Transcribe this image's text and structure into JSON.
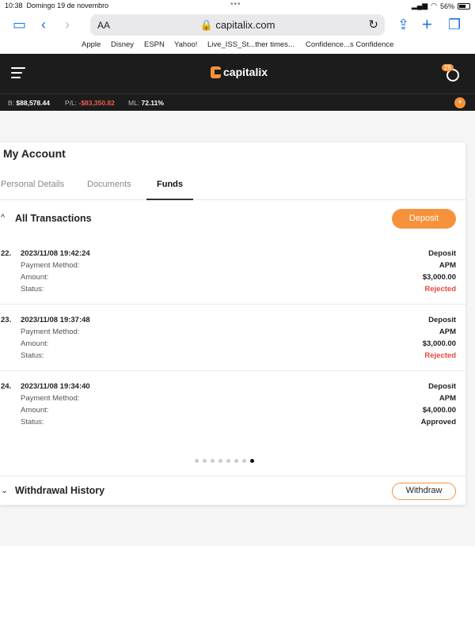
{
  "status_bar": {
    "time": "10:38",
    "date": "Domingo 19 de novembro",
    "battery": "56%"
  },
  "browser": {
    "aa_label": "AA",
    "url": "capitalix.com",
    "bookmarks": [
      "Apple",
      "Disney",
      "ESPN",
      "Yahoo!",
      "Live_ISS_St...ther times...",
      "Confidence...s Confidence"
    ]
  },
  "header": {
    "logo_text": "capitalix",
    "notification_count": "26"
  },
  "stats": {
    "balance_label": "B:",
    "balance_value": "$88,578.44",
    "pl_label": "P/L:",
    "pl_value": "-$83,350.82",
    "ml_label": "ML:",
    "ml_value": "72.11%"
  },
  "account": {
    "title": "My Account",
    "tabs": [
      "Personal Details",
      "Documents",
      "Funds"
    ],
    "active_tab": "Funds"
  },
  "transactions": {
    "title": "All Transactions",
    "deposit_label": "Deposit",
    "field_labels": {
      "method": "Payment Method:",
      "amount": "Amount:",
      "status": "Status:"
    },
    "items": [
      {
        "num": "22.",
        "date": "2023/11/08 19:42:24",
        "type": "Deposit",
        "method": "APM",
        "amount": "$3,000.00",
        "status": "Rejected"
      },
      {
        "num": "23.",
        "date": "2023/11/08 19:37:48",
        "type": "Deposit",
        "method": "APM",
        "amount": "$3,000.00",
        "status": "Rejected"
      },
      {
        "num": "24.",
        "date": "2023/11/08 19:34:40",
        "type": "Deposit",
        "method": "APM",
        "amount": "$4,000.00",
        "status": "Approved"
      }
    ],
    "pages": 8,
    "active_page": 8
  },
  "withdrawals": {
    "title": "Withdrawal History",
    "withdraw_label": "Withdraw"
  },
  "colors": {
    "accent": "#f7923a",
    "header_bg": "#1c1c1c",
    "negative": "#e8473c"
  }
}
